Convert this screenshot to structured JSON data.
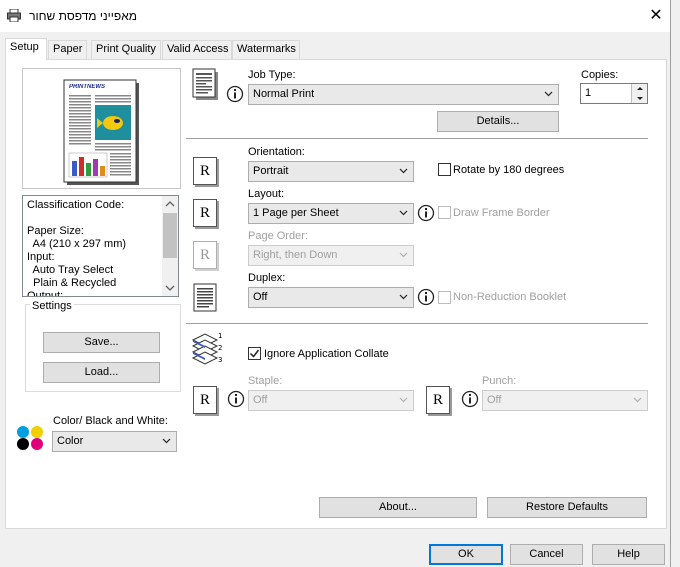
{
  "window": {
    "title": "מאפייני מדפסת שחור",
    "close_label": "✕"
  },
  "tabs": [
    {
      "label": "Setup"
    },
    {
      "label": "Paper"
    },
    {
      "label": "Print Quality"
    },
    {
      "label": "Valid Access"
    },
    {
      "label": "Watermarks"
    }
  ],
  "job": {
    "label": "Job Type:",
    "value": "Normal Print",
    "details_button": "Details..."
  },
  "copies": {
    "label": "Copies:",
    "value": "1"
  },
  "orientation": {
    "label": "Orientation:",
    "value": "Portrait",
    "rotate_label": "Rotate by 180 degrees"
  },
  "layout": {
    "label": "Layout:",
    "value": "1 Page per Sheet",
    "frame_label": "Draw Frame Border"
  },
  "page_order": {
    "label": "Page Order:",
    "value": "Right, then Down"
  },
  "duplex": {
    "label": "Duplex:",
    "value": "Off",
    "booklet_label": "Non-Reduction Booklet"
  },
  "collate": {
    "label": "Ignore Application Collate",
    "checked": true
  },
  "staple": {
    "label": "Staple:",
    "value": "Off"
  },
  "punch": {
    "label": "Punch:",
    "value": "Off"
  },
  "info_lines": "Classification Code:\n\nPaper Size:\n  A4 (210 x 297 mm)\nInput:\n  Auto Tray Select\n  Plain & Recycled\nOutput:",
  "settings": {
    "title": "Settings",
    "save_button": "Save...",
    "load_button": "Load..."
  },
  "color": {
    "label": "Color/ Black and White:",
    "value": "Color"
  },
  "preview": {
    "headline": "PRINTNEWS"
  },
  "buttons": {
    "about": "About...",
    "restore": "Restore Defaults",
    "ok": "OK",
    "cancel": "Cancel",
    "help": "Help"
  },
  "colors": {
    "accent": "#0078d7",
    "dialog_bg": "#f0f0f0"
  }
}
